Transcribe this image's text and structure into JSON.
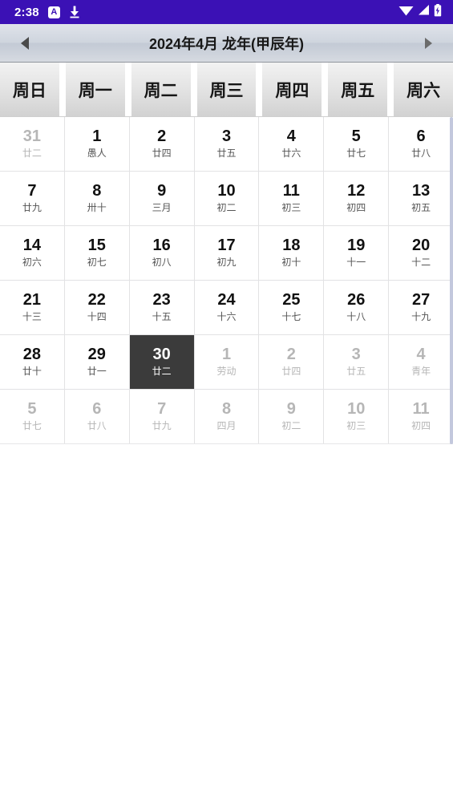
{
  "status_bar": {
    "time": "2:38",
    "left_icons": [
      {
        "name": "app-badge-a-icon",
        "glyph": "A"
      },
      {
        "name": "download-icon",
        "glyph": "download"
      }
    ],
    "right_icons": [
      {
        "name": "wifi-icon"
      },
      {
        "name": "cellular-signal-icon"
      },
      {
        "name": "battery-charging-icon"
      }
    ],
    "background_color": "#3b11b5"
  },
  "header": {
    "title": "2024年4月  龙年(甲辰年)",
    "prev_icon": "triangle-left-icon",
    "next_icon": "triangle-right-icon"
  },
  "weekdays": [
    "周日",
    "周一",
    "周二",
    "周三",
    "周四",
    "周五",
    "周六"
  ],
  "calendar": {
    "selected_day": "30",
    "selected_color": "#3b3b3b",
    "rows": [
      [
        {
          "day": "31",
          "lunar": "廿二",
          "out": true
        },
        {
          "day": "1",
          "lunar": "愚人",
          "out": false
        },
        {
          "day": "2",
          "lunar": "廿四",
          "out": false
        },
        {
          "day": "3",
          "lunar": "廿五",
          "out": false
        },
        {
          "day": "4",
          "lunar": "廿六",
          "out": false
        },
        {
          "day": "5",
          "lunar": "廿七",
          "out": false
        },
        {
          "day": "6",
          "lunar": "廿八",
          "out": false
        }
      ],
      [
        {
          "day": "7",
          "lunar": "廿九",
          "out": false
        },
        {
          "day": "8",
          "lunar": "卅十",
          "out": false
        },
        {
          "day": "9",
          "lunar": "三月",
          "out": false
        },
        {
          "day": "10",
          "lunar": "初二",
          "out": false
        },
        {
          "day": "11",
          "lunar": "初三",
          "out": false
        },
        {
          "day": "12",
          "lunar": "初四",
          "out": false
        },
        {
          "day": "13",
          "lunar": "初五",
          "out": false
        }
      ],
      [
        {
          "day": "14",
          "lunar": "初六",
          "out": false
        },
        {
          "day": "15",
          "lunar": "初七",
          "out": false
        },
        {
          "day": "16",
          "lunar": "初八",
          "out": false
        },
        {
          "day": "17",
          "lunar": "初九",
          "out": false
        },
        {
          "day": "18",
          "lunar": "初十",
          "out": false
        },
        {
          "day": "19",
          "lunar": "十一",
          "out": false
        },
        {
          "day": "20",
          "lunar": "十二",
          "out": false
        }
      ],
      [
        {
          "day": "21",
          "lunar": "十三",
          "out": false
        },
        {
          "day": "22",
          "lunar": "十四",
          "out": false
        },
        {
          "day": "23",
          "lunar": "十五",
          "out": false
        },
        {
          "day": "24",
          "lunar": "十六",
          "out": false
        },
        {
          "day": "25",
          "lunar": "十七",
          "out": false
        },
        {
          "day": "26",
          "lunar": "十八",
          "out": false
        },
        {
          "day": "27",
          "lunar": "十九",
          "out": false
        }
      ],
      [
        {
          "day": "28",
          "lunar": "廿十",
          "out": false
        },
        {
          "day": "29",
          "lunar": "廿一",
          "out": false
        },
        {
          "day": "30",
          "lunar": "廿二",
          "out": false,
          "selected": true
        },
        {
          "day": "1",
          "lunar": "劳动",
          "out": true
        },
        {
          "day": "2",
          "lunar": "廿四",
          "out": true
        },
        {
          "day": "3",
          "lunar": "廿五",
          "out": true
        },
        {
          "day": "4",
          "lunar": "青年",
          "out": true
        }
      ],
      [
        {
          "day": "5",
          "lunar": "廿七",
          "out": true
        },
        {
          "day": "6",
          "lunar": "廿八",
          "out": true
        },
        {
          "day": "7",
          "lunar": "廿九",
          "out": true
        },
        {
          "day": "8",
          "lunar": "四月",
          "out": true
        },
        {
          "day": "9",
          "lunar": "初二",
          "out": true
        },
        {
          "day": "10",
          "lunar": "初三",
          "out": true
        },
        {
          "day": "11",
          "lunar": "初四",
          "out": true
        }
      ]
    ]
  }
}
